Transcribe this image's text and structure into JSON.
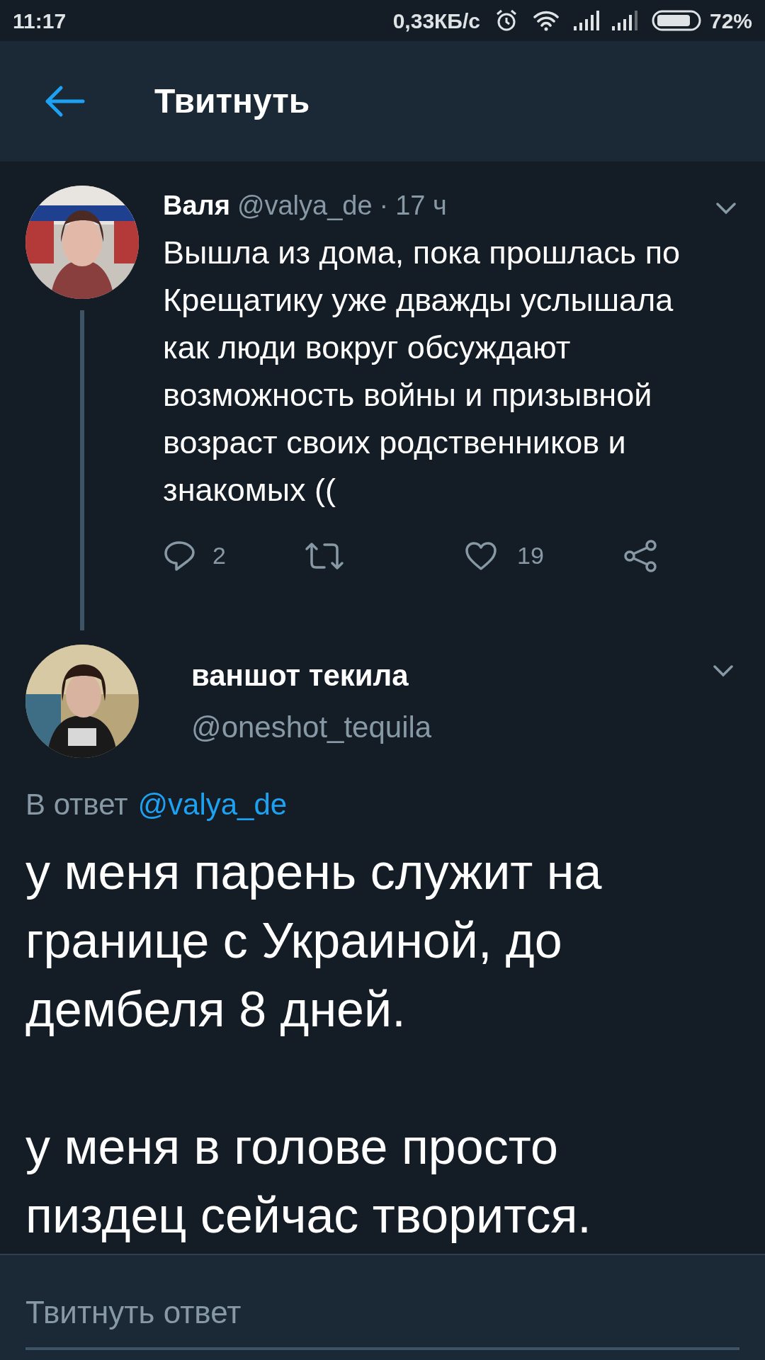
{
  "status_bar": {
    "time": "11:17",
    "network_speed": "0,33КБ/с",
    "battery": "72%"
  },
  "header": {
    "title": "Твитнуть"
  },
  "tweets": [
    {
      "kind": "parent",
      "name": "Валя",
      "handle": "@valya_de",
      "separator": "·",
      "time": "17 ч",
      "text": "Вышла из дома, пока прошлась по Крещатику уже дважды услышала как люди вокруг обсуждают возможность войны и призывной возраст своих родственников и знакомых ((",
      "reply_count": "2",
      "like_count": "19"
    },
    {
      "kind": "focused",
      "name": "ваншот текила",
      "handle": "@oneshot_tequila",
      "reply_label": "В ответ",
      "reply_handle": "@valya_de",
      "paragraphs": [
        "у меня парень служит на границе с Украиной, до дембеля 8 дней.",
        "у меня в голове просто пиздец сейчас творится."
      ]
    }
  ],
  "reply_box": {
    "placeholder": "Твитнуть ответ"
  }
}
